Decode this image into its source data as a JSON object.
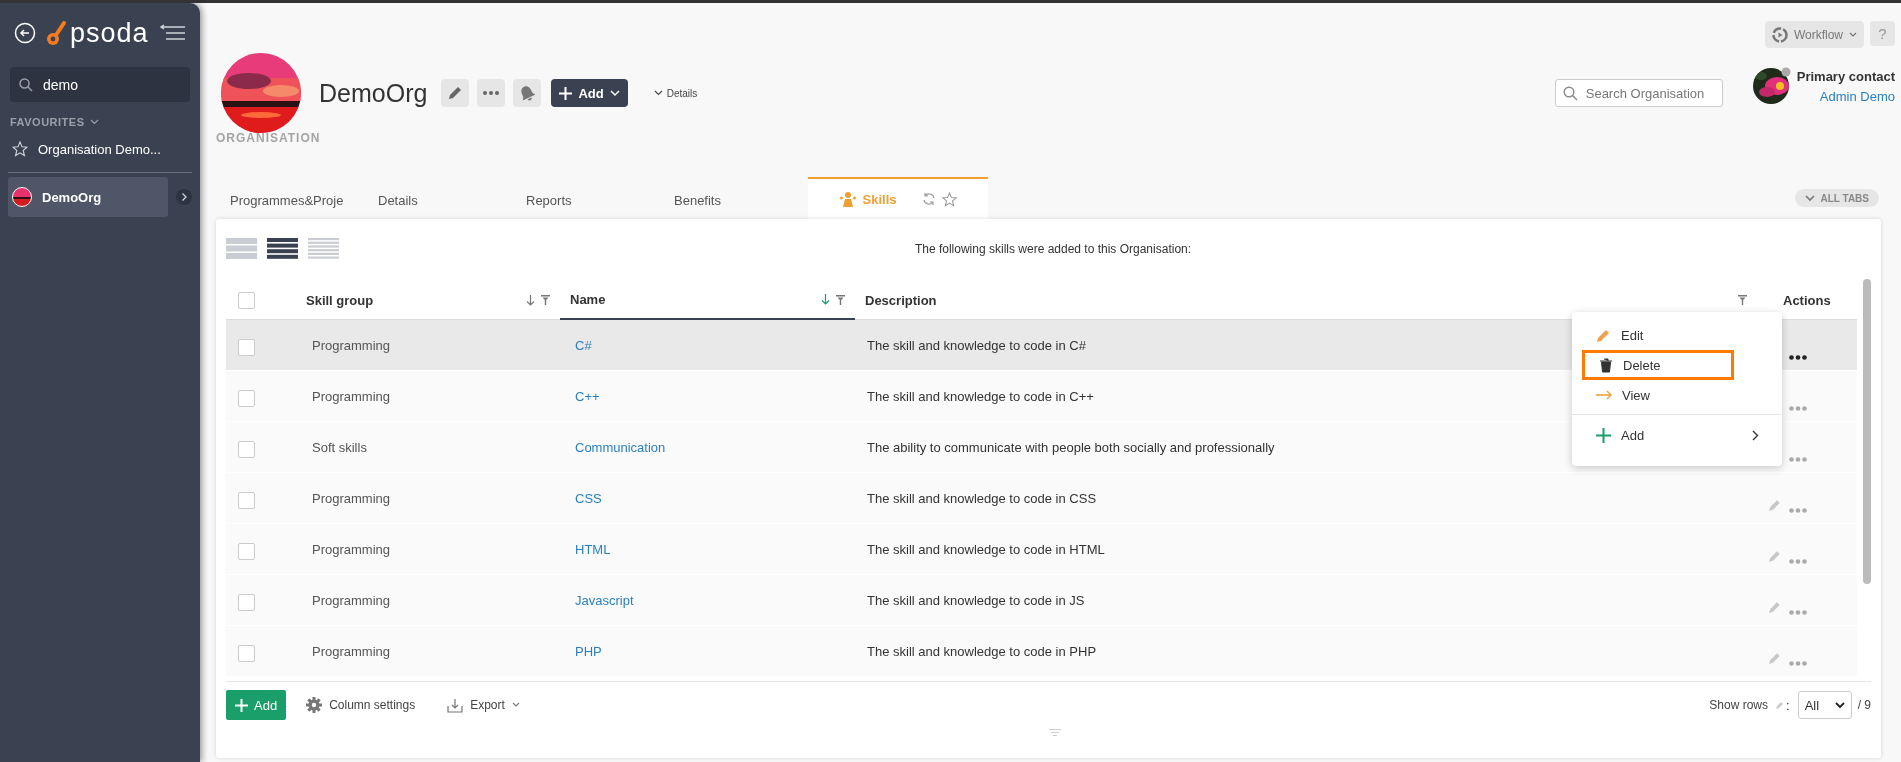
{
  "sidebar": {
    "logo": "psoda",
    "search": {
      "value": "demo"
    },
    "favourites_label": "FAVOURITES",
    "favourites": [
      "Organisation Demo..."
    ],
    "items": [
      {
        "label": "DemoOrg",
        "selected": true
      }
    ]
  },
  "toolbar": {
    "workflow": "Workflow",
    "help": "?"
  },
  "header": {
    "title": "DemoOrg",
    "add_button": "Add",
    "details": "Details",
    "type": "ORGANISATION",
    "search": {
      "placeholder": "Search Organisation"
    },
    "contact_label": "Primary contact",
    "contact_name": "Admin Demo"
  },
  "tabs": [
    {
      "label": "Programmes&Proje",
      "selected": false
    },
    {
      "label": "Details",
      "selected": false
    },
    {
      "label": "Reports",
      "selected": false
    },
    {
      "label": "Benefits",
      "selected": false
    },
    {
      "label": "Skills",
      "selected": true
    }
  ],
  "all_tabs": "ALL TABS",
  "view_modes": [
    {
      "selected": false
    },
    {
      "selected": true
    },
    {
      "selected": false
    }
  ],
  "caption": "The following skills were added to this Organisation:",
  "select_all": {
    "checked": false
  },
  "columns": [
    {
      "label": "Skill group",
      "sort_active": false,
      "filter": true
    },
    {
      "label": "Name",
      "sort_active": true,
      "filter": true
    },
    {
      "label": "Description",
      "filter": true
    },
    {
      "label": "Actions"
    }
  ],
  "rows": [
    {
      "group": "Programming",
      "name": "C#",
      "description": "The skill and knowledge to code in C#",
      "checked": false,
      "highlighted": true
    },
    {
      "group": "Programming",
      "name": "C++",
      "description": "The skill and knowledge to code in C++",
      "checked": false,
      "highlighted": false
    },
    {
      "group": "Soft skills",
      "name": "Communication",
      "description": "The ability to communicate with people both socially and professionally",
      "checked": false,
      "highlighted": false
    },
    {
      "group": "Programming",
      "name": "CSS",
      "description": "The skill and knowledge to code in CSS",
      "checked": false,
      "highlighted": false,
      "edit_icon": true
    },
    {
      "group": "Programming",
      "name": "HTML",
      "description": "The skill and knowledge to code in HTML",
      "checked": false,
      "highlighted": false,
      "edit_icon": true
    },
    {
      "group": "Programming",
      "name": "Javascript",
      "description": "The skill and knowledge to code in JS",
      "checked": false,
      "highlighted": false,
      "edit_icon": true
    },
    {
      "group": "Programming",
      "name": "PHP",
      "description": "The skill and knowledge to code in PHP",
      "checked": false,
      "highlighted": false,
      "edit_icon": true
    }
  ],
  "menu": [
    {
      "kind": "edit",
      "label": "Edit",
      "highlighted": false
    },
    {
      "kind": "delete",
      "label": "Delete",
      "highlighted": true
    },
    {
      "kind": "view",
      "label": "View",
      "highlighted": false
    },
    {
      "kind": "add",
      "label": "Add",
      "highlighted": false
    }
  ],
  "footer": {
    "add": "Add",
    "column_settings": "Column settings",
    "export": "Export",
    "show_rows": "Show rows",
    "separator": ":",
    "rows_value": "All",
    "total": "/ 9"
  }
}
